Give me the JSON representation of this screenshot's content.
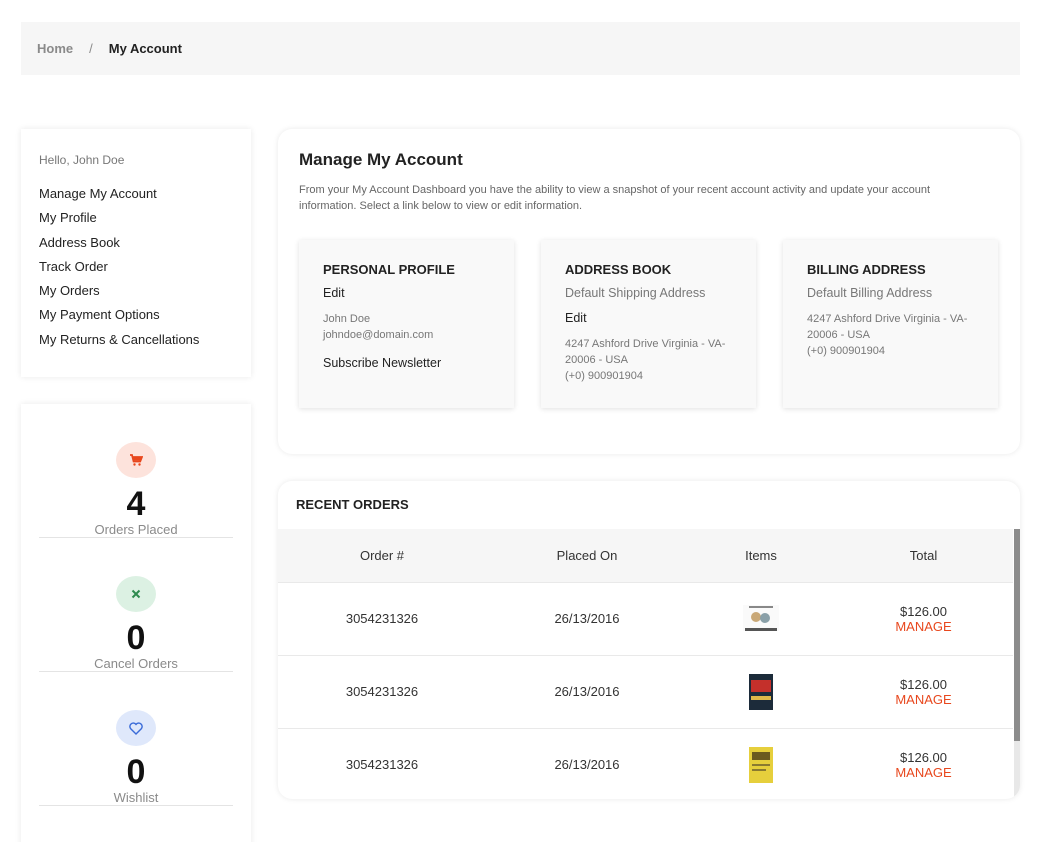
{
  "breadcrumb": {
    "home": "Home",
    "separator": "/",
    "current": "My Account"
  },
  "sidebar": {
    "greeting": "Hello, John Doe",
    "items": [
      {
        "label": "Manage My Account"
      },
      {
        "label": "My Profile"
      },
      {
        "label": "Address Book"
      },
      {
        "label": "Track Order"
      },
      {
        "label": "My Orders"
      },
      {
        "label": "My Payment Options"
      },
      {
        "label": "My Returns & Cancellations"
      }
    ]
  },
  "stats": [
    {
      "icon": "cart-icon",
      "value": "4",
      "label": "Orders Placed",
      "color": "#e8471d",
      "bg": "#fde3dc"
    },
    {
      "icon": "close-icon",
      "value": "0",
      "label": "Cancel Orders",
      "color": "#2e8b4f",
      "bg": "#dcf1e3"
    },
    {
      "icon": "heart-icon",
      "value": "0",
      "label": "Wishlist",
      "color": "#3a6bd8",
      "bg": "#dfe8fb"
    }
  ],
  "manage": {
    "title": "Manage My Account",
    "description": "From your My Account Dashboard you have the ability to view a snapshot of your recent account activity and update your account information. Select a link below to view or edit information.",
    "profile": {
      "title": "PERSONAL PROFILE",
      "edit": "Edit",
      "name": "John Doe",
      "email": "johndoe@domain.com",
      "newsletter": "Subscribe Newsletter"
    },
    "address": {
      "title": "ADDRESS BOOK",
      "subtitle": "Default Shipping Address",
      "edit": "Edit",
      "line1": "4247 Ashford Drive Virginia - VA-",
      "line2": "20006 - USA",
      "phone": "(+0) 900901904"
    },
    "billing": {
      "title": "BILLING ADDRESS",
      "subtitle": "Default Billing Address",
      "line1": "4247 Ashford Drive Virginia - VA-",
      "line2": "20006 - USA",
      "phone": "(+0) 900901904"
    }
  },
  "orders": {
    "title": "RECENT ORDERS",
    "headers": [
      "Order #",
      "Placed On",
      "Items",
      "Total"
    ],
    "rows": [
      {
        "id": "3054231326",
        "date": "26/13/2016",
        "total": "$126.00",
        "action": "MANAGE"
      },
      {
        "id": "3054231326",
        "date": "26/13/2016",
        "total": "$126.00",
        "action": "MANAGE"
      },
      {
        "id": "3054231326",
        "date": "26/13/2016",
        "total": "$126.00",
        "action": "MANAGE"
      }
    ]
  },
  "accent": "#e8471d"
}
